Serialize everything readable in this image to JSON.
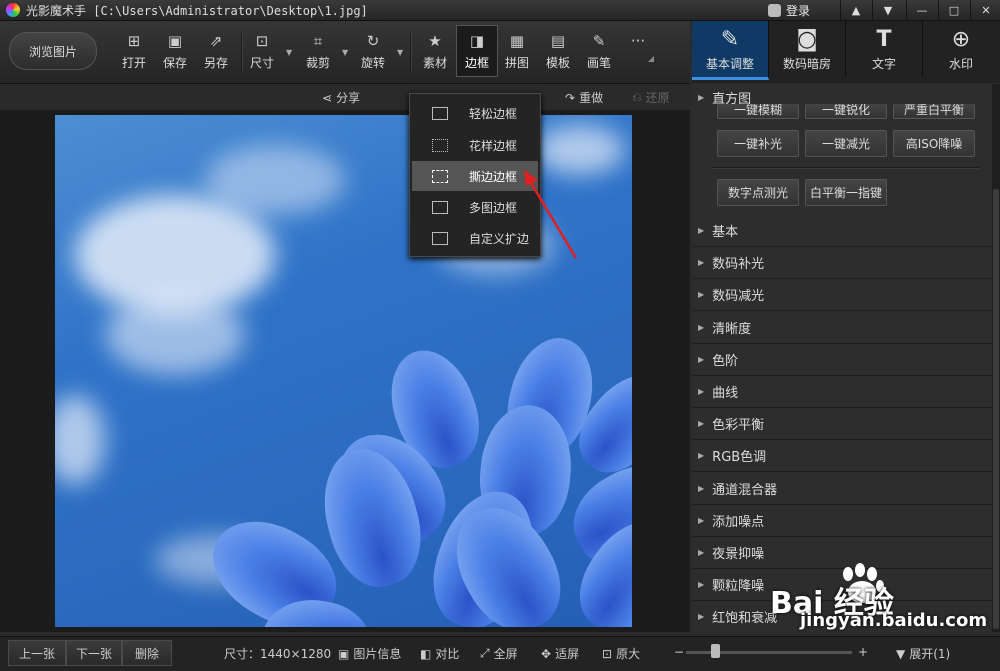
{
  "titlebar": {
    "app_name": "光影魔术手",
    "file_path": "[C:\\Users\\Administrator\\Desktop\\1.jpg]",
    "login_label": "登录"
  },
  "toolbar": {
    "browse_label": "浏览图片",
    "tools": [
      {
        "label": "打开",
        "icon": "open-icon"
      },
      {
        "label": "保存",
        "icon": "save-icon"
      },
      {
        "label": "另存",
        "icon": "save-as-icon"
      },
      {
        "label": "尺寸",
        "icon": "resize-icon"
      },
      {
        "label": "裁剪",
        "icon": "crop-icon"
      },
      {
        "label": "旋转",
        "icon": "rotate-icon"
      },
      {
        "label": "素材",
        "icon": "material-icon"
      },
      {
        "label": "边框",
        "icon": "border-icon"
      },
      {
        "label": "拼图",
        "icon": "collage-icon"
      },
      {
        "label": "模板",
        "icon": "template-icon"
      },
      {
        "label": "画笔",
        "icon": "brush-icon"
      }
    ],
    "more_label": "···"
  },
  "right_tabs": [
    {
      "label": "基本调整",
      "icon": "basic-adjust-icon"
    },
    {
      "label": "数码暗房",
      "icon": "darkroom-icon"
    },
    {
      "label": "文字",
      "icon": "text-icon"
    },
    {
      "label": "水印",
      "icon": "watermark-icon"
    }
  ],
  "subbar": {
    "share": "分享",
    "redo": "重做",
    "restore": "还原"
  },
  "border_menu": {
    "items": [
      "轻松边框",
      "花样边框",
      "撕边边框",
      "多图边框",
      "自定义扩边"
    ],
    "highlighted": "撕边边框"
  },
  "right_panel": {
    "histogram_label": "直方图",
    "partial_row": [
      "一键模糊",
      "一键锐化",
      "严重白平衡"
    ],
    "quick_row1": [
      "一键补光",
      "一键减光",
      "高ISO降噪"
    ],
    "quick_row2": [
      "数字点测光",
      "白平衡一指键"
    ],
    "sections": [
      "基本",
      "数码补光",
      "数码减光",
      "清晰度",
      "色阶",
      "曲线",
      "色彩平衡",
      "RGB色调",
      "通道混合器",
      "添加噪点",
      "夜景抑噪",
      "颗粒降噪",
      "红饱和衰减"
    ]
  },
  "statusbar": {
    "prev": "上一张",
    "next": "下一张",
    "delete": "删除",
    "size_label": "尺寸：1440×1280",
    "info": "图片信息",
    "compare": "对比",
    "fullscreen": "全屏",
    "fit": "适屏",
    "original": "原大",
    "expand": "展开(1)",
    "zoom_level": 0.15
  },
  "watermark": {
    "brand": "Bai 经验",
    "url": "jingyan.baidu.com"
  }
}
